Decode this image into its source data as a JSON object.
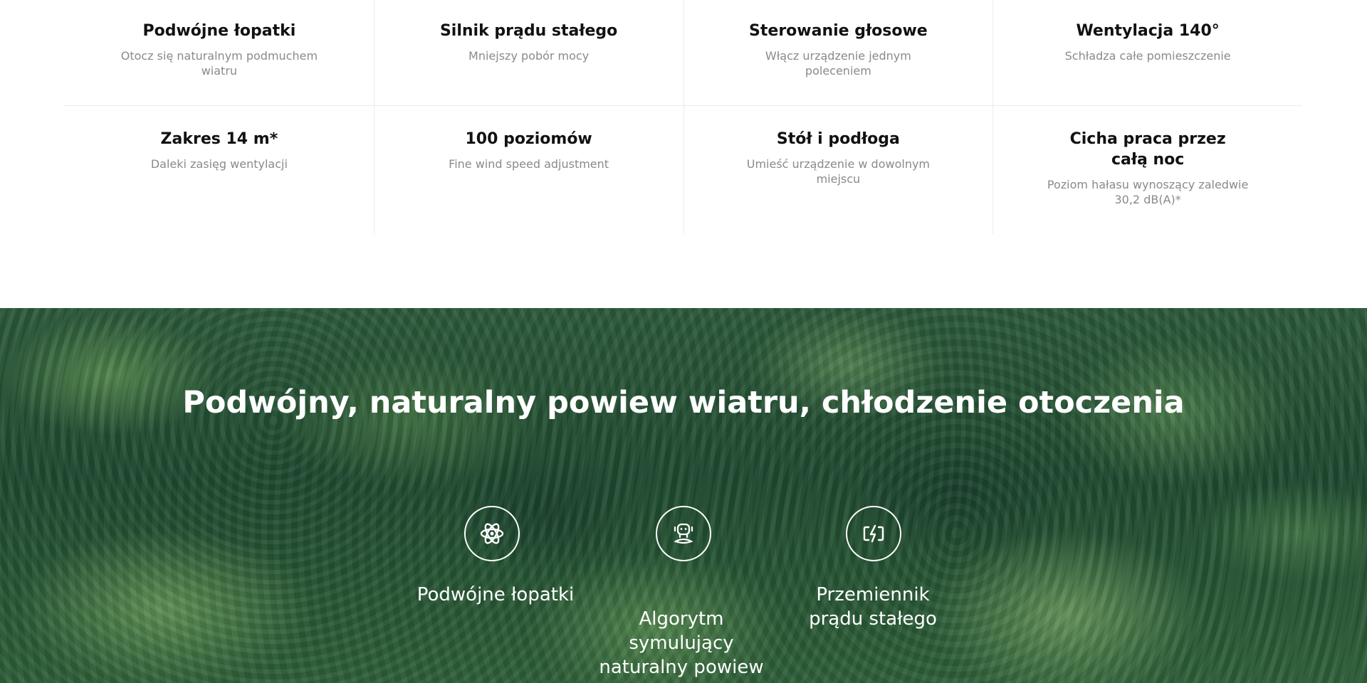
{
  "features": [
    [
      {
        "title": "Podwójne łopatki",
        "subtitle": "Otocz się naturalnym podmuchem wiatru"
      },
      {
        "title": "Silnik prądu stałego",
        "subtitle": "Mniejszy pobór mocy"
      },
      {
        "title": "Sterowanie głosowe",
        "subtitle": "Włącz urządzenie jednym poleceniem"
      },
      {
        "title": "Wentylacja 140°",
        "subtitle": "Schładza całe pomieszczenie"
      }
    ],
    [
      {
        "title": "Zakres 14 m*",
        "subtitle": "Daleki zasięg wentylacji"
      },
      {
        "title": "100 poziomów",
        "subtitle": "Fine wind speed adjustment"
      },
      {
        "title": "Stół i podłoga",
        "subtitle": "Umieść urządzenie w dowolnym miejscu"
      },
      {
        "title": "Cicha praca przez całą noc",
        "subtitle": "Poziom hałasu wynoszący zaledwie 30,2 dB(A)*"
      }
    ]
  ],
  "hero": {
    "title": "Podwójny, naturalny powiew wiatru, chłodzenie otoczenia",
    "items": [
      {
        "label": "Podwójne łopatki",
        "icon": "atom-icon"
      },
      {
        "label": "Algorytm symulujący naturalny powiew",
        "icon": "robot-icon"
      },
      {
        "label": "Przemiennik prądu stałego",
        "icon": "power-bolt-icon"
      }
    ]
  },
  "colors": {
    "title_text": "#111111",
    "subtitle_text": "#8a8a8a",
    "divider": "#ececec",
    "forest_dark": "#1f4a30",
    "forest_light": "#6fa860",
    "hero_text": "#ffffff"
  }
}
